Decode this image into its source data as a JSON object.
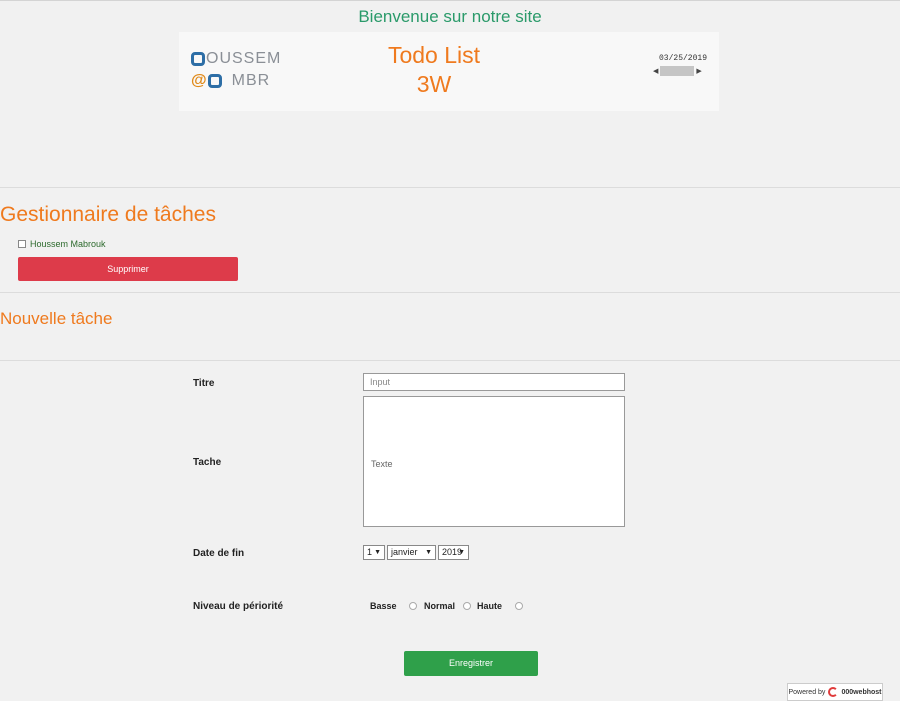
{
  "header": {
    "welcome": "Bienvenue sur notre site"
  },
  "banner": {
    "logo_line1": "HOUSSEM",
    "logo_line1_rest": "OUSSEM",
    "logo_line2_at": "@",
    "logo_line2_text": "MBR",
    "title_line1": "Todo List",
    "title_line2": "3W",
    "date": "03/25/2019"
  },
  "manager": {
    "heading": "Gestionnaire de tâches",
    "tasks": [
      {
        "label": "Houssem Mabrouk",
        "checked": false
      }
    ],
    "delete_label": "Supprimer"
  },
  "new_task": {
    "heading": "Nouvelle tâche",
    "title_label": "Titre",
    "title_placeholder": "Input",
    "task_label": "Tache",
    "task_placeholder": "Texte",
    "date_label": "Date de fin",
    "day_value": "1",
    "month_value": "janvier",
    "year_value": "2019",
    "priority_label": "Niveau de périorité",
    "priorities": [
      "Basse",
      "Normal",
      "Haute"
    ],
    "save_label": "Enregistrer"
  },
  "footer": {
    "powered_by": "Powered by",
    "brand": "000webhost"
  },
  "colors": {
    "accent_orange": "#ef7a1e",
    "welcome_green": "#2a9a6a",
    "delete_red": "#dd3b4a",
    "save_green": "#2fa04a"
  }
}
